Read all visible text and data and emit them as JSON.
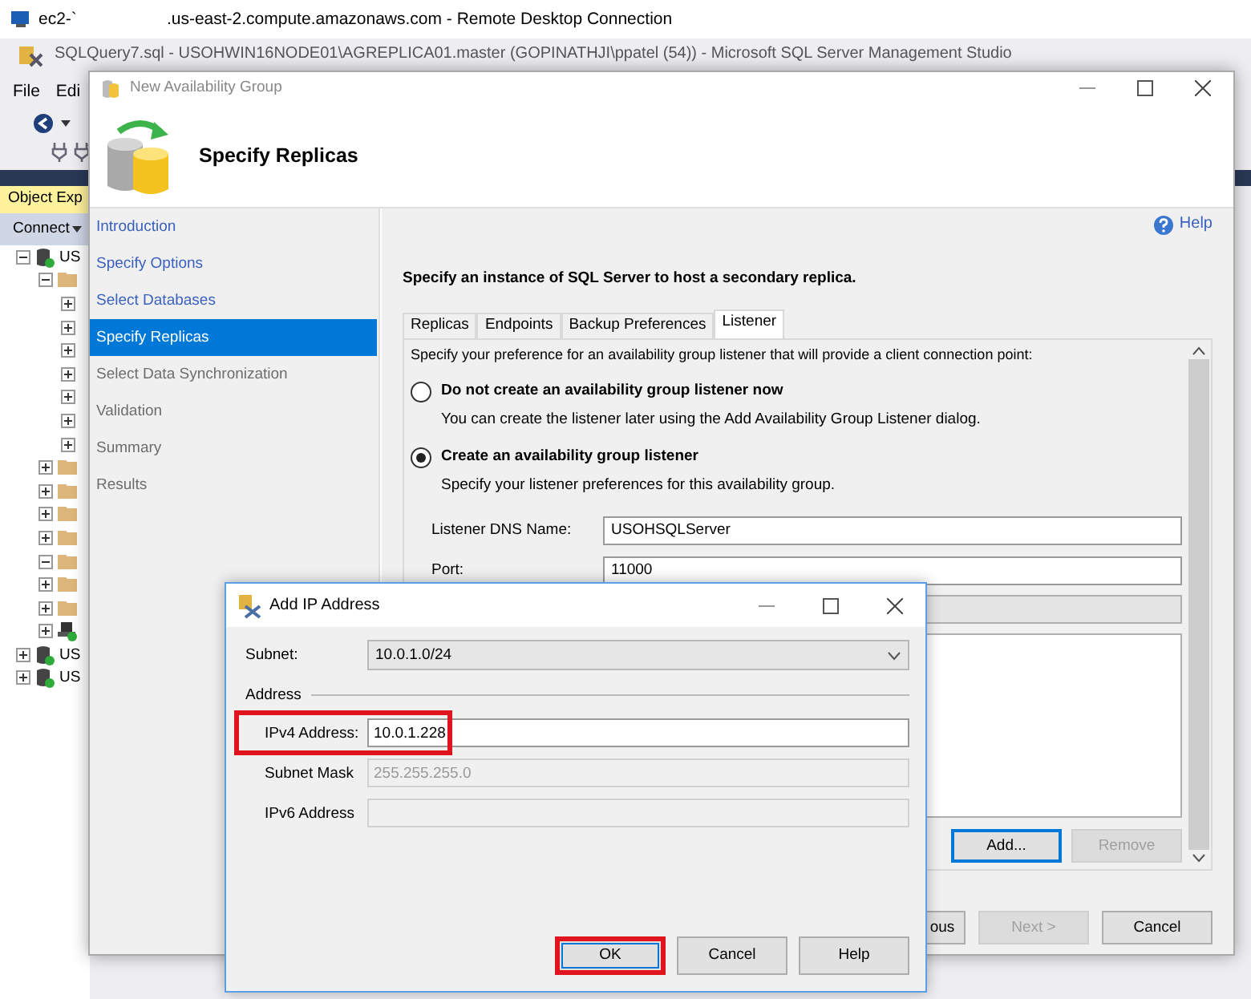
{
  "remote_desktop": {
    "title_host": "ec2-`",
    "title_rest": ".us-east-2.compute.amazonaws.com - Remote Desktop Connection"
  },
  "ssms": {
    "title": "SQLQuery7.sql - USOHWIN16NODE01\\AGREPLICA01.master (GOPINATHJI\\ppatel (54)) - Microsoft SQL Server Management Studio",
    "menu": [
      "File",
      "Edi"
    ],
    "object_explorer": {
      "title": "Object Exp",
      "connect": "Connect",
      "tree": [
        {
          "kind": "server",
          "label": "US",
          "expanded": true,
          "children": [
            {
              "kind": "folder",
              "expanded": true,
              "children": [
                {
                  "expanded": false
                },
                {
                  "expanded": false
                },
                {
                  "expanded": false
                },
                {
                  "expanded": false
                },
                {
                  "expanded": false
                },
                {
                  "expanded": false
                },
                {
                  "expanded": false
                }
              ]
            },
            {
              "kind": "folder",
              "expanded": false
            },
            {
              "kind": "folder",
              "expanded": false
            },
            {
              "kind": "folder",
              "expanded": false
            },
            {
              "kind": "folder",
              "expanded": false
            },
            {
              "kind": "folder",
              "expanded": true
            },
            {
              "kind": "folder",
              "expanded": false
            },
            {
              "kind": "folder",
              "expanded": false
            },
            {
              "kind": "agent",
              "expanded": false
            }
          ]
        },
        {
          "kind": "server",
          "label": "US",
          "expanded": false
        },
        {
          "kind": "server",
          "label": "US",
          "expanded": false
        }
      ]
    }
  },
  "wizard": {
    "title": "New Availability Group",
    "heading": "Specify Replicas",
    "steps": [
      {
        "label": "Introduction",
        "selected": false,
        "enabled": true
      },
      {
        "label": "Specify Options",
        "selected": false,
        "enabled": true
      },
      {
        "label": "Select Databases",
        "selected": false,
        "enabled": true
      },
      {
        "label": "Specify Replicas",
        "selected": true,
        "enabled": true
      },
      {
        "label": "Select Data Synchronization",
        "selected": false,
        "enabled": false
      },
      {
        "label": "Validation",
        "selected": false,
        "enabled": false
      },
      {
        "label": "Summary",
        "selected": false,
        "enabled": false
      },
      {
        "label": "Results",
        "selected": false,
        "enabled": false
      }
    ],
    "help": "Help",
    "instruction": "Specify an instance of SQL Server to host a secondary replica.",
    "tabs": [
      {
        "label": "Replicas",
        "selected": false
      },
      {
        "label": "Endpoints",
        "selected": false
      },
      {
        "label": "Backup Preferences",
        "selected": false
      },
      {
        "label": "Listener",
        "selected": true
      }
    ],
    "listener": {
      "intro": "Specify your preference for an availability group listener that will provide a client connection point:",
      "options": [
        {
          "label": "Do not create an availability group listener now",
          "description": "You can create the listener later using the Add Availability Group Listener dialog.",
          "selected": false
        },
        {
          "label": "Create an availability group listener",
          "description": "Specify your listener preferences for this availability group.",
          "selected": true
        }
      ],
      "fields": [
        {
          "label": "Listener DNS Name:",
          "value": "USOHSQLServer"
        },
        {
          "label": "Port:",
          "value": "11000"
        }
      ],
      "buttons": [
        {
          "label": "Add...",
          "disabled": false
        },
        {
          "label": "Remove",
          "disabled": true
        }
      ]
    },
    "buttons": [
      {
        "label": "ous",
        "disabled": false
      },
      {
        "label": "Next >",
        "disabled": true
      },
      {
        "label": "Cancel",
        "disabled": false
      }
    ]
  },
  "add_ip_dialog": {
    "title": "Add IP Address",
    "subnet": {
      "label": "Subnet:",
      "value": "10.0.1.0/24"
    },
    "group": "Address",
    "fields": [
      {
        "label": "IPv4 Address:",
        "value": "10.0.1.228",
        "disabled": false,
        "highlighted": true
      },
      {
        "label": "Subnet Mask",
        "value": "255.255.255.0",
        "disabled": true,
        "highlighted": false
      },
      {
        "label": "IPv6 Address",
        "disabled": true,
        "highlighted": false
      }
    ],
    "buttons": [
      {
        "label": "OK",
        "highlighted": true
      },
      {
        "label": "Cancel",
        "highlighted": false
      },
      {
        "label": "Help",
        "highlighted": false
      }
    ]
  }
}
